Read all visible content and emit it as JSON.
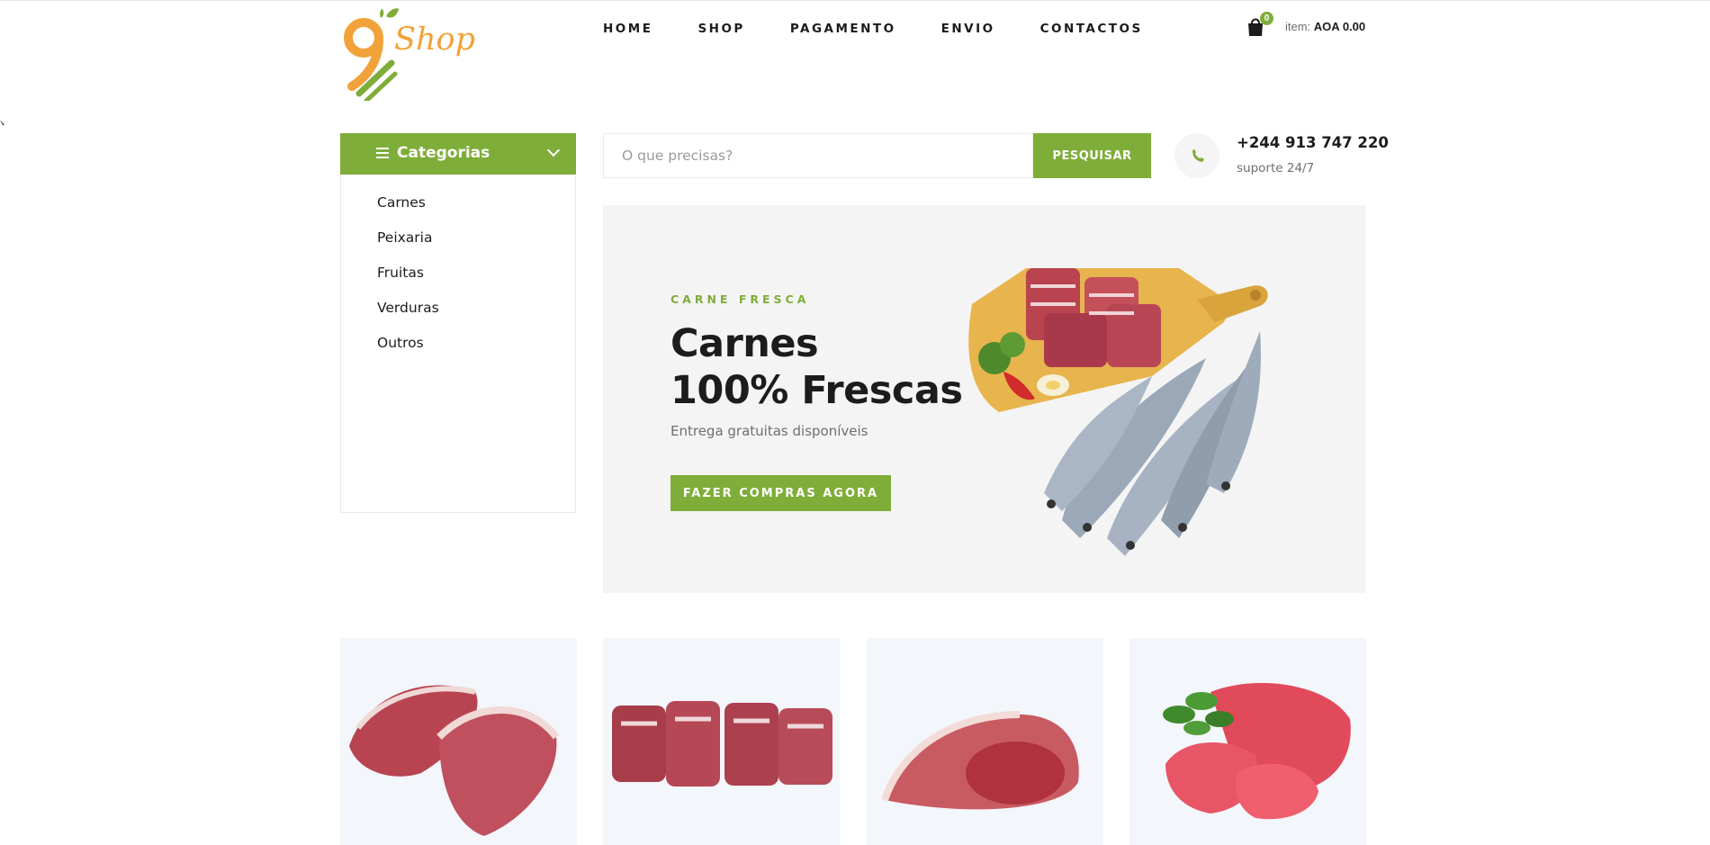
{
  "header": {
    "logo_text": "Shop",
    "nav": [
      {
        "label": "HOME"
      },
      {
        "label": "SHOP"
      },
      {
        "label": "PAGAMENTO"
      },
      {
        "label": "ENVIO"
      },
      {
        "label": "CONTACTOS"
      }
    ],
    "cart": {
      "count": "0",
      "label": "item:",
      "total": "AOA 0.00",
      "icon": "shopping-bag-icon"
    }
  },
  "sidebar": {
    "title": "Categorias",
    "items": [
      {
        "label": "Carnes"
      },
      {
        "label": "Peixaria"
      },
      {
        "label": "Fruitas"
      },
      {
        "label": "Verduras"
      },
      {
        "label": "Outros"
      }
    ]
  },
  "search": {
    "placeholder": "O que precisas?",
    "button_label": "PESQUISAR"
  },
  "contact": {
    "phone": "+244 913 747 220",
    "support": "suporte 24/7",
    "icon": "phone-icon"
  },
  "hero": {
    "kicker": "CARNE FRESCA",
    "title_line1": "Carnes",
    "title_line2": "100% Frescas",
    "subtitle": "Entrega gratuitas disponíveis",
    "button_label": "FAZER COMPRAS AGORA"
  },
  "colors": {
    "accent": "#7fad39",
    "logo_orange": "#f2a23a",
    "text": "#1c1c1c",
    "muted": "#6f6f6f"
  }
}
